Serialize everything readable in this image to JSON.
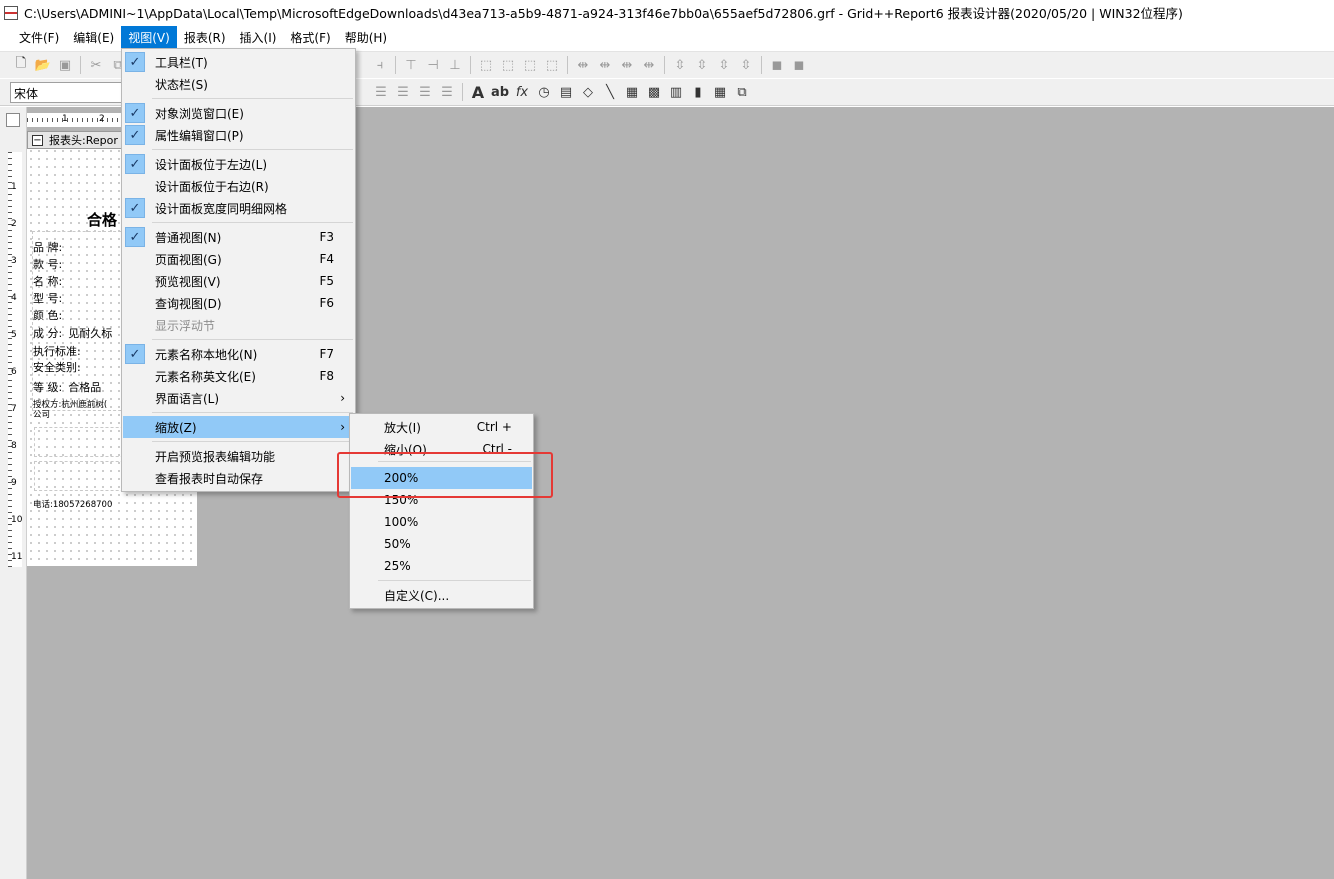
{
  "window": {
    "title": "C:\\Users\\ADMINI~1\\AppData\\Local\\Temp\\MicrosoftEdgeDownloads\\d43ea713-a5b9-4871-a924-313f46e7bb0a\\655aef5d72806.grf - Grid++Report6 报表设计器(2020/05/20 | WIN32位程序)",
    "icon": "app-icon"
  },
  "menubar": {
    "items": [
      "文件(F)",
      "编辑(E)",
      "视图(V)",
      "报表(R)",
      "插入(I)",
      "格式(F)",
      "帮助(H)"
    ],
    "active_index": 2
  },
  "toolbar": {
    "font_name": "宋体"
  },
  "designer": {
    "ruler_marks": [
      "1",
      "2"
    ],
    "vertical_ruler": [
      "1",
      "2",
      "3",
      "4",
      "5",
      "6",
      "7",
      "8",
      "9",
      "10",
      "11"
    ],
    "section_title": "报表头:Repor",
    "report_title": "合格",
    "fields": [
      {
        "label": "品  牌:",
        "value": ""
      },
      {
        "label": "款  号:",
        "value": ""
      },
      {
        "label": "名  称:",
        "value": ""
      },
      {
        "label": "型  号:",
        "value": ""
      },
      {
        "label": "颜  色:",
        "value": ""
      },
      {
        "label": "成  分:",
        "value": "见耐久标"
      },
      {
        "label": "执行标准:",
        "value": ""
      },
      {
        "label": "安全类别:",
        "value": ""
      },
      {
        "label": "等  级:",
        "value": "合格品"
      }
    ],
    "auth_line1": "授权方:杭州鹿前树(",
    "auth_line2": "公司",
    "phone": "电话:18057268700"
  },
  "view_menu": {
    "items": [
      {
        "label": "工具栏(T)",
        "checked": true,
        "shortcut": "",
        "submenu": false,
        "disabled": false
      },
      {
        "label": "状态栏(S)",
        "checked": false,
        "shortcut": "",
        "submenu": false,
        "disabled": false
      },
      {
        "label": "对象浏览窗口(E)",
        "checked": true,
        "shortcut": "",
        "submenu": false,
        "disabled": false
      },
      {
        "label": "属性编辑窗口(P)",
        "checked": true,
        "shortcut": "",
        "submenu": false,
        "disabled": false
      },
      {
        "label": "设计面板位于左边(L)",
        "checked": true,
        "shortcut": "",
        "submenu": false,
        "disabled": false
      },
      {
        "label": "设计面板位于右边(R)",
        "checked": false,
        "shortcut": "",
        "submenu": false,
        "disabled": false
      },
      {
        "label": "设计面板宽度同明细网格",
        "checked": true,
        "shortcut": "",
        "submenu": false,
        "disabled": false
      },
      {
        "label": "普通视图(N)",
        "checked": true,
        "shortcut": "F3",
        "submenu": false,
        "disabled": false
      },
      {
        "label": "页面视图(G)",
        "checked": false,
        "shortcut": "F4",
        "submenu": false,
        "disabled": false
      },
      {
        "label": "预览视图(V)",
        "checked": false,
        "shortcut": "F5",
        "submenu": false,
        "disabled": false
      },
      {
        "label": "查询视图(D)",
        "checked": false,
        "shortcut": "F6",
        "submenu": false,
        "disabled": false
      },
      {
        "label": "显示浮动节",
        "checked": false,
        "shortcut": "",
        "submenu": false,
        "disabled": true
      },
      {
        "label": "元素名称本地化(N)",
        "checked": true,
        "shortcut": "F7",
        "submenu": false,
        "disabled": false
      },
      {
        "label": "元素名称英文化(E)",
        "checked": false,
        "shortcut": "F8",
        "submenu": false,
        "disabled": false
      },
      {
        "label": "界面语言(L)",
        "checked": false,
        "shortcut": "",
        "submenu": true,
        "disabled": false
      },
      {
        "label": "缩放(Z)",
        "checked": false,
        "shortcut": "",
        "submenu": true,
        "disabled": false,
        "highlighted": true
      },
      {
        "label": "开启预览报表编辑功能",
        "checked": false,
        "shortcut": "",
        "submenu": false,
        "disabled": false
      },
      {
        "label": "查看报表时自动保存",
        "checked": false,
        "shortcut": "",
        "submenu": false,
        "disabled": false
      }
    ]
  },
  "zoom_menu": {
    "items": [
      {
        "label": "放大(I)",
        "shortcut": "Ctrl +"
      },
      {
        "label": "缩小(O)",
        "shortcut": "Ctrl -"
      },
      {
        "label": "200%",
        "shortcut": "",
        "highlighted": true
      },
      {
        "label": "150%",
        "shortcut": ""
      },
      {
        "label": "100%",
        "shortcut": ""
      },
      {
        "label": "50%",
        "shortcut": ""
      },
      {
        "label": "25%",
        "shortcut": ""
      },
      {
        "label": "自定义(C)...",
        "shortcut": ""
      }
    ]
  },
  "colors": {
    "highlight": "#91c9f7",
    "menubar_active": "#0078d7",
    "annotation_box": "#e53935",
    "workspace": "#b3b3b3"
  }
}
